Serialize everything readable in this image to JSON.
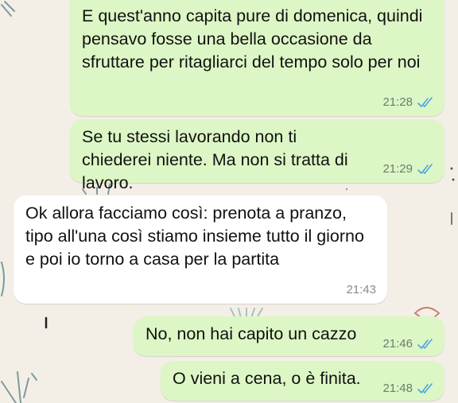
{
  "colors": {
    "background": "#f4efe6",
    "outgoing_bubble": "#dcf7c5",
    "incoming_bubble": "#ffffff",
    "read_ticks": "#4fa3e3"
  },
  "messages": [
    {
      "direction": "outgoing",
      "text": "E quest'anno capita pure di domenica, quindi pensavo fosse una bella occasione da sfruttare per ritagliarci del tempo solo per noi",
      "time": "21:28",
      "status_icon": "double-check-read-icon"
    },
    {
      "direction": "outgoing",
      "text": "Se tu stessi lavorando non ti chiederei niente. Ma non si tratta di lavoro.",
      "time": "21:29",
      "status_icon": "double-check-read-icon"
    },
    {
      "direction": "incoming",
      "text": "Ok allora facciamo così: prenota a pranzo, tipo all'una così stiamo insieme tutto il giorno e poi io torno a casa per la partita",
      "time": "21:43"
    },
    {
      "direction": "outgoing",
      "text": "No, non hai capito un cazzo",
      "time": "21:46",
      "status_icon": "double-check-read-icon"
    },
    {
      "direction": "outgoing",
      "text": "O vieni a cena, o è finita.",
      "time": "21:48",
      "status_icon": "double-check-read-icon"
    }
  ]
}
